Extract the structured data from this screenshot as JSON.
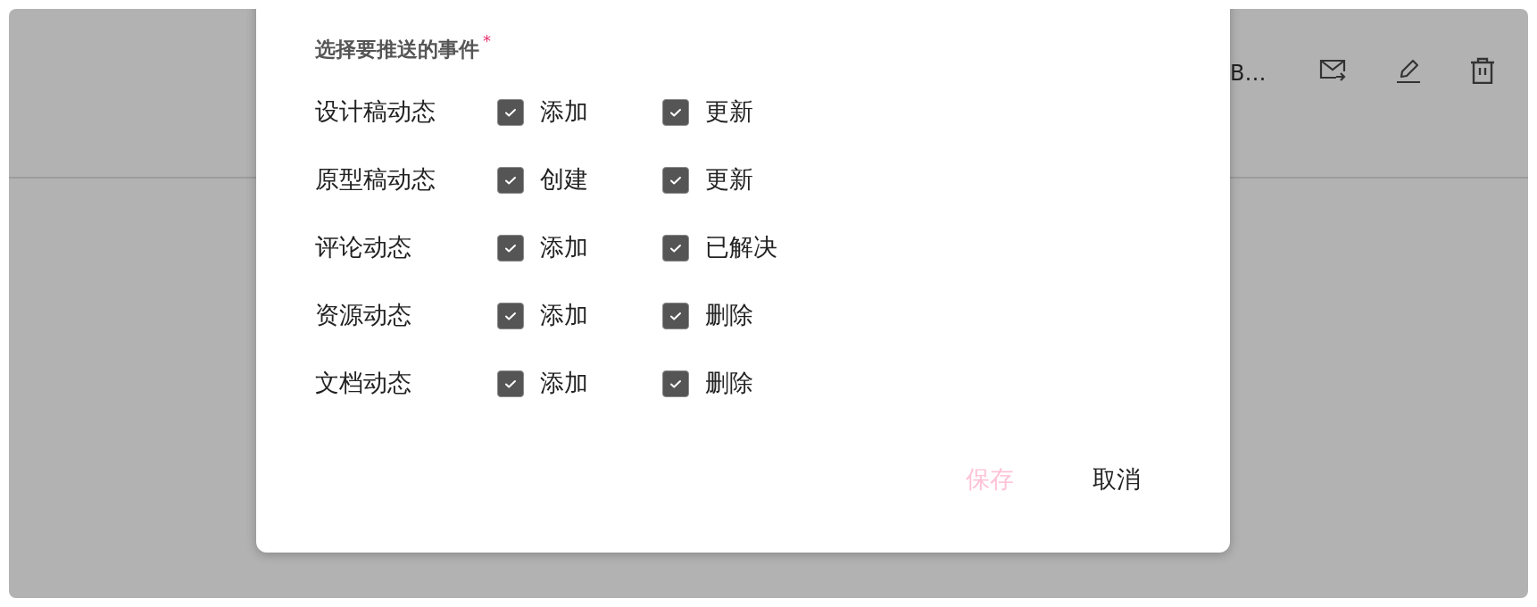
{
  "background": {
    "truncated_text": "B…"
  },
  "dialog": {
    "section_title": "选择要推送的事件",
    "required_mark": "*",
    "events": [
      {
        "label": "设计稿动态",
        "options": [
          {
            "label": "添加",
            "checked": true
          },
          {
            "label": "更新",
            "checked": true
          }
        ]
      },
      {
        "label": "原型稿动态",
        "options": [
          {
            "label": "创建",
            "checked": true
          },
          {
            "label": "更新",
            "checked": true
          }
        ]
      },
      {
        "label": "评论动态",
        "options": [
          {
            "label": "添加",
            "checked": true
          },
          {
            "label": "已解决",
            "checked": true
          }
        ]
      },
      {
        "label": "资源动态",
        "options": [
          {
            "label": "添加",
            "checked": true
          },
          {
            "label": "删除",
            "checked": true
          }
        ]
      },
      {
        "label": "文档动态",
        "options": [
          {
            "label": "添加",
            "checked": true
          },
          {
            "label": "删除",
            "checked": true
          }
        ]
      }
    ],
    "buttons": [
      {
        "label": "保存",
        "disabled": true
      },
      {
        "label": "取消",
        "disabled": false
      }
    ]
  }
}
